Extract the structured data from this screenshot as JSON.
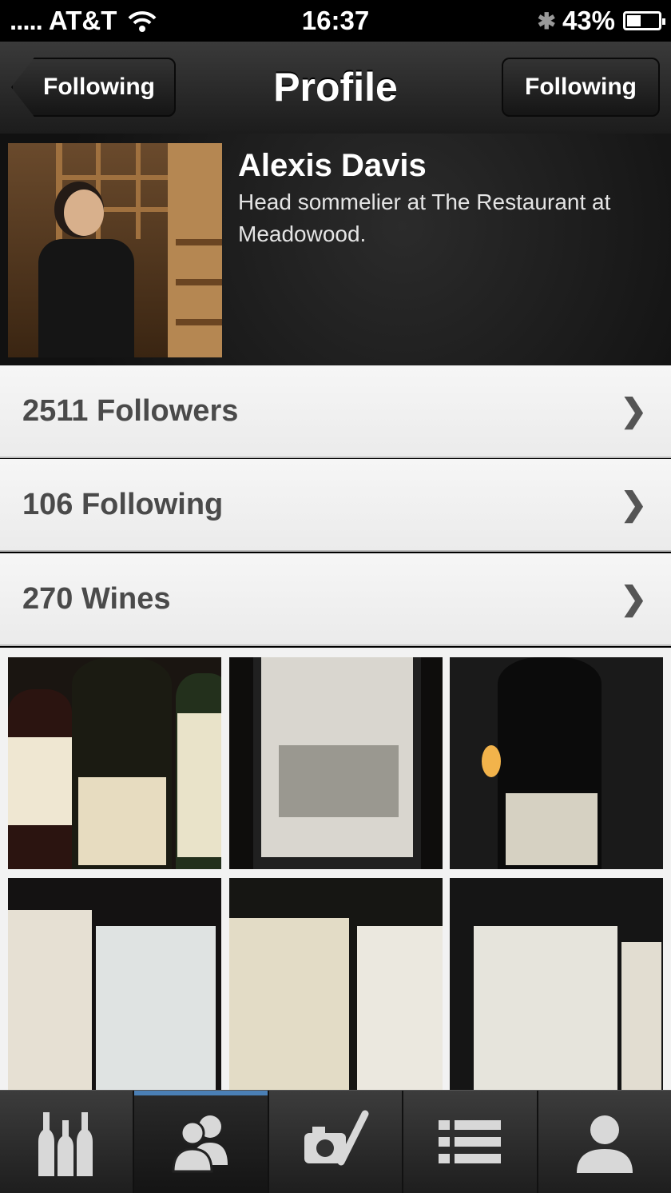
{
  "status_bar": {
    "carrier": "AT&T",
    "time": "16:37",
    "battery_percent": "43%",
    "signal_icon": "signal-dots-icon",
    "wifi_icon": "wifi-icon",
    "bluetooth_icon": "bluetooth-icon"
  },
  "nav": {
    "back_label": "Following",
    "title": "Profile",
    "follow_label": "Following"
  },
  "profile": {
    "name": "Alexis Davis",
    "bio": "Head sommelier at The Restaurant at Meadowood."
  },
  "stats": [
    {
      "label": "2511 Followers"
    },
    {
      "label": "106 Following"
    },
    {
      "label": "270 Wines"
    }
  ],
  "gallery": {
    "photos": [
      "wine-photo-1",
      "wine-photo-2",
      "wine-photo-3",
      "wine-photo-4",
      "wine-photo-5",
      "wine-photo-6"
    ]
  },
  "tabbar": {
    "tabs": [
      {
        "icon": "bottles-icon",
        "active": false
      },
      {
        "icon": "friends-icon",
        "active": true
      },
      {
        "icon": "camera-icon",
        "active": false
      },
      {
        "icon": "list-icon",
        "active": false
      },
      {
        "icon": "profile-icon",
        "active": false
      }
    ],
    "active_color": "#4a7fb5"
  }
}
